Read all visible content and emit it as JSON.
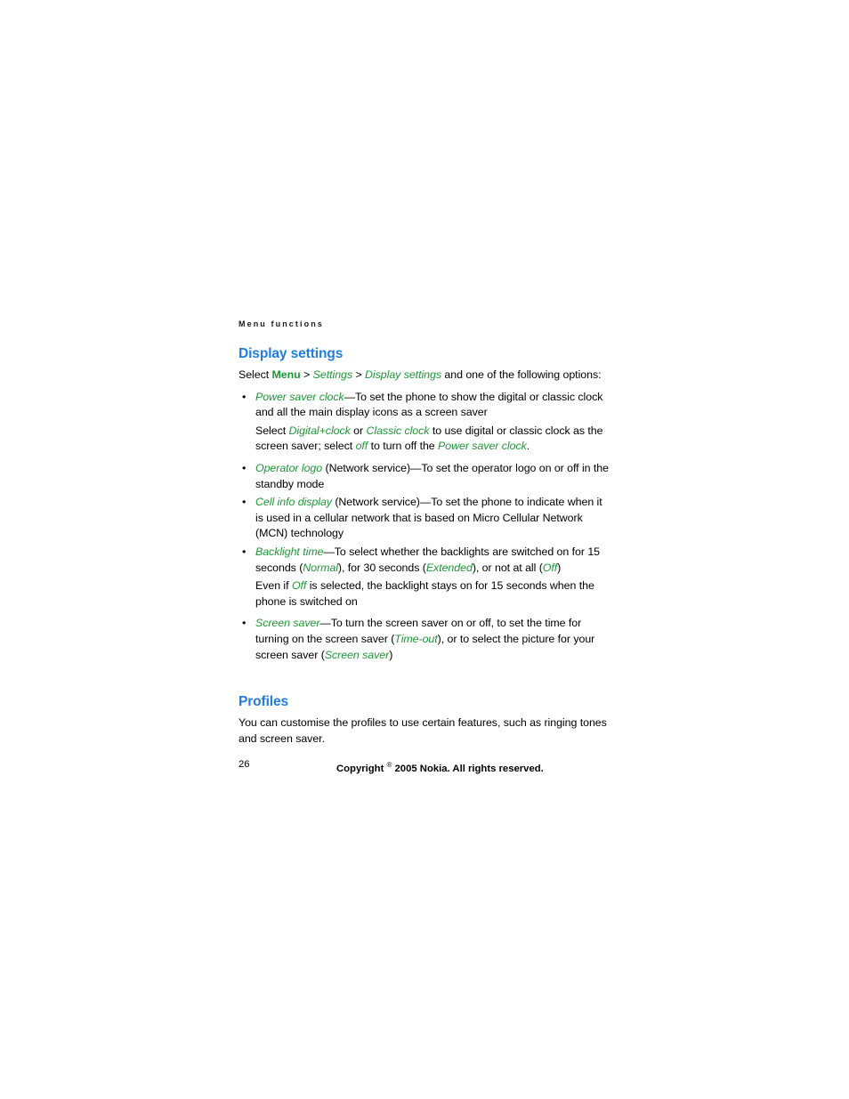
{
  "running_header": "Menu functions",
  "sections": [
    {
      "heading": "Display settings",
      "intro": {
        "prefix": "Select ",
        "menu": "Menu",
        "sep1": " > ",
        "settings": "Settings",
        "sep2": " > ",
        "display_settings": "Display settings",
        "suffix": " and one of the following options:"
      },
      "bullets": [
        {
          "term": "Power saver clock",
          "text": "—To set the phone to show the digital or classic clock and all the main display icons as a screen saver",
          "sub_paragraph": {
            "part1": "Select ",
            "em1": "Digital+clock",
            "part2": " or ",
            "em2": "Classic clock",
            "part3": " to use digital or classic clock as the screen saver; select ",
            "em3": "off",
            "part4": " to turn off the ",
            "em4": "Power saver clock",
            "part5": "."
          }
        },
        {
          "term": "Operator logo",
          "text": " (Network service)—To set the operator logo on or off in the standby mode"
        },
        {
          "term": "Cell info display",
          "text": " (Network service)—To set the phone to indicate when it is used in a cellular network that is based on Micro Cellular Network (MCN) technology"
        },
        {
          "term": "Backlight time",
          "text_a": "—To select whether the backlights are switched on for 15 seconds (",
          "em_a": "Normal",
          "text_b": "), for 30 seconds (",
          "em_b": "Extended",
          "text_c": "), or not at all (",
          "em_c": "Off",
          "text_d": ")",
          "sub_paragraph": {
            "part1": "Even if ",
            "em1": "Off",
            "part2": " is selected, the backlight stays on for 15 seconds when the phone is switched on"
          }
        },
        {
          "term": "Screen saver",
          "text_a": "—To turn the screen saver on or off, to set the time for turning on the screen saver (",
          "em_a": "Time-out",
          "text_b": "), or to select the picture for your screen saver (",
          "em_b": "Screen saver",
          "text_c": ")"
        }
      ]
    },
    {
      "heading": "Profiles",
      "body": "You can customise the profiles to use certain features, such as ringing tones and screen saver."
    }
  ],
  "footer": {
    "page_number": "26",
    "copyright_prefix": "Copyright ",
    "copyright_symbol": "®",
    "copyright_suffix": " 2005 Nokia. All rights reserved."
  },
  "colors": {
    "heading_blue": "#1f7ddb",
    "emphasis_green": "#1e9637",
    "body_black": "#000000"
  }
}
